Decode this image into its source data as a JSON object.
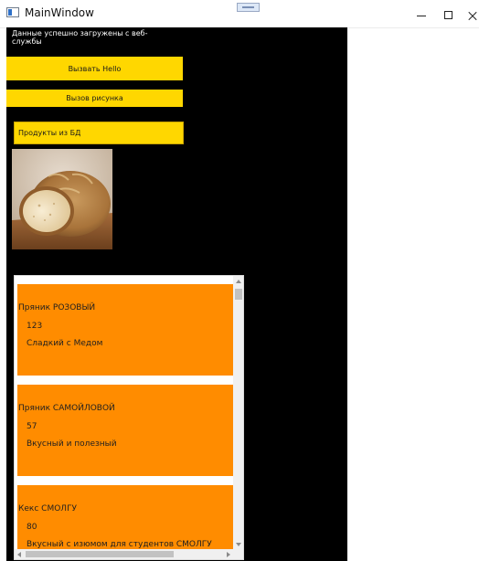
{
  "window": {
    "title": "MainWindow"
  },
  "status": {
    "message": "Данные успешно загружены с веб-службы"
  },
  "buttons": {
    "hello": "Вызвать Hello",
    "picture": "Вызов рисунка",
    "products": "Продукты из БД"
  },
  "image": {
    "icon": "bread-image"
  },
  "products": [
    {
      "name": "Пряник РОЗОВЫЙ",
      "price": "123",
      "description": "Сладкий с Медом"
    },
    {
      "name": "Пряник САМОЙЛОВОЙ",
      "price": "57",
      "description": "Вкусный и полезный"
    },
    {
      "name": "Кекс СМОЛГУ",
      "price": "80",
      "description": "Вкусный с изюмом для студентов СМОЛГУ"
    }
  ],
  "colors": {
    "content_background": "#000000",
    "button_yellow": "#ffd700",
    "item_orange": "#ff8c00"
  }
}
